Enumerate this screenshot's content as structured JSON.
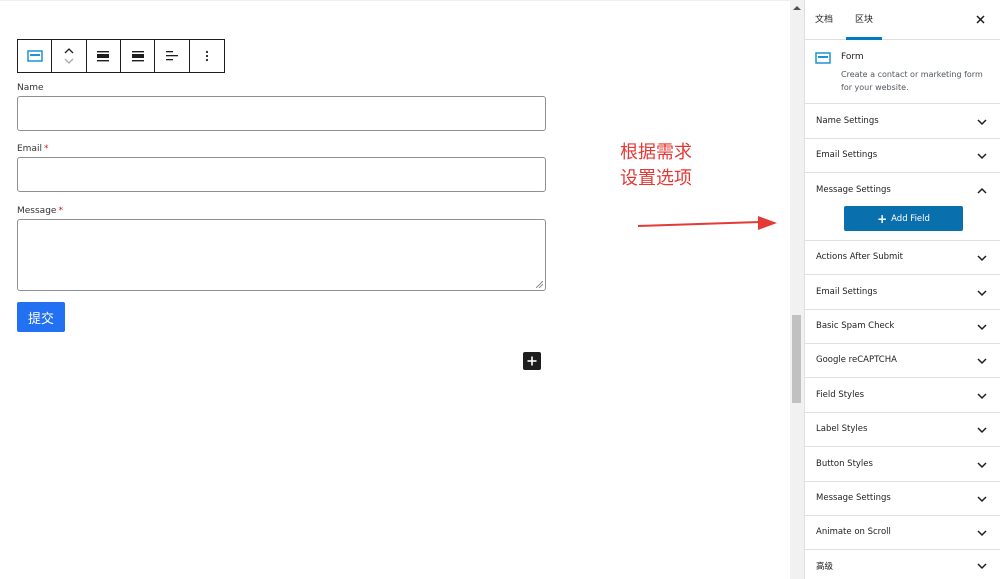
{
  "toolbar": {
    "icons": [
      "form-block-icon",
      "move-up-down-icon",
      "align-wide-icon",
      "align-full-icon",
      "justify-left-icon",
      "more-options-icon"
    ]
  },
  "form": {
    "name_label": "Name",
    "email_label": "Email",
    "message_label": "Message",
    "required_marker": "*",
    "submit_label": "提交"
  },
  "annotation": {
    "line1": "根据需求",
    "line2": "设置选项",
    "color": "#e53935"
  },
  "sidebar": {
    "tabs": [
      {
        "label": "文档"
      },
      {
        "label": "区块",
        "active": true
      }
    ],
    "close_icon": "close-icon",
    "block": {
      "title": "Form",
      "description": "Create a contact or marketing form for your website."
    },
    "panels": [
      {
        "label": "Name Settings"
      },
      {
        "label": "Email Settings"
      },
      {
        "label": "Message Settings",
        "expanded": true
      },
      {
        "label": "Actions After Submit"
      },
      {
        "label": "Email Settings"
      },
      {
        "label": "Basic Spam Check"
      },
      {
        "label": "Google reCAPTCHA"
      },
      {
        "label": "Field Styles"
      },
      {
        "label": "Label Styles"
      },
      {
        "label": "Button Styles"
      },
      {
        "label": "Message Settings"
      },
      {
        "label": "Animate on Scroll"
      },
      {
        "label": "高级"
      }
    ],
    "add_field_label": "Add Field"
  },
  "colors": {
    "submit": "#2271f3",
    "add_field": "#0a6fad",
    "tab_accent": "#007cba",
    "required": "#cc1818"
  }
}
